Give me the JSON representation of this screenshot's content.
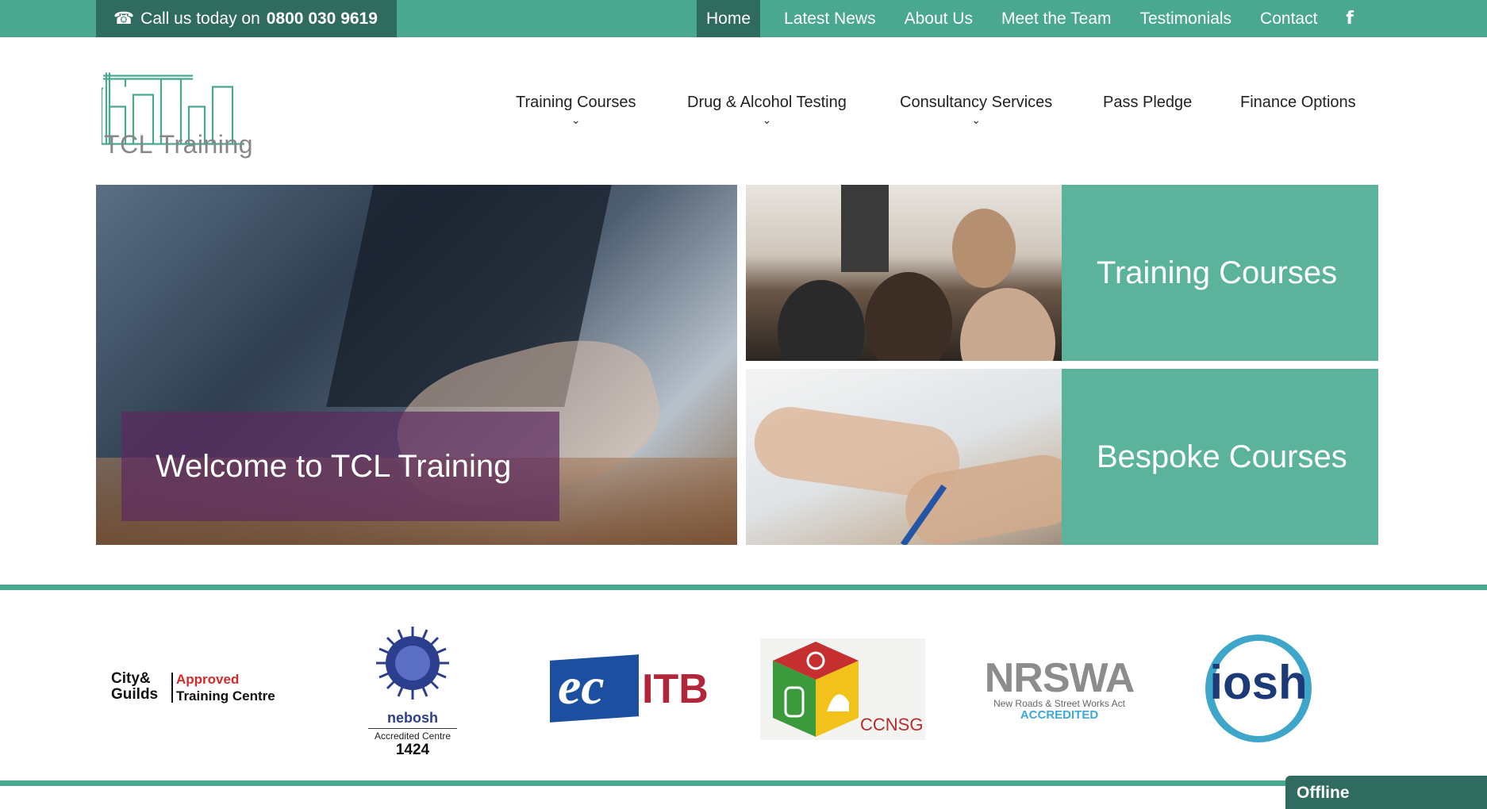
{
  "topbar": {
    "call_text": "Call us today on",
    "phone": "0800 030 9619",
    "nav": [
      "Home",
      "Latest News",
      "About Us",
      "Meet the Team",
      "Testimonials",
      "Contact"
    ],
    "social_icon": "facebook-icon"
  },
  "header": {
    "logo_text": "TCL Training",
    "nav": [
      {
        "label": "Training Courses",
        "has_dropdown": true
      },
      {
        "label": "Drug & Alcohol Testing",
        "has_dropdown": true
      },
      {
        "label": "Consultancy Services",
        "has_dropdown": true
      },
      {
        "label": "Pass Pledge",
        "has_dropdown": false
      },
      {
        "label": "Finance Options",
        "has_dropdown": false
      }
    ]
  },
  "hero": {
    "welcome": "Welcome to TCL Training",
    "tiles": [
      {
        "label": "Training Courses"
      },
      {
        "label": "Bespoke Courses"
      }
    ]
  },
  "accreditations": {
    "city_guilds": {
      "brand_top": "City&",
      "brand_bottom": "Guilds",
      "approved": "Approved",
      "centre": "Training Centre"
    },
    "nebosh": {
      "name": "nebosh",
      "caption": "Accredited Centre",
      "number": "1424"
    },
    "ecitb": {
      "ec": "ec",
      "itb": "ITB"
    },
    "ccnsg": {
      "name": "CCNSG"
    },
    "nrswa": {
      "name": "NRSWA",
      "subtitle": "New Roads & Street Works Act",
      "accredited": "ACCREDITED"
    },
    "iosh": {
      "name": "iosh"
    }
  },
  "chat": {
    "status": "Offline"
  },
  "colors": {
    "teal": "#4aa890",
    "dark_teal": "#2f6b5e",
    "tile_teal": "#5bb39c",
    "purple": "#5c2a5f"
  }
}
